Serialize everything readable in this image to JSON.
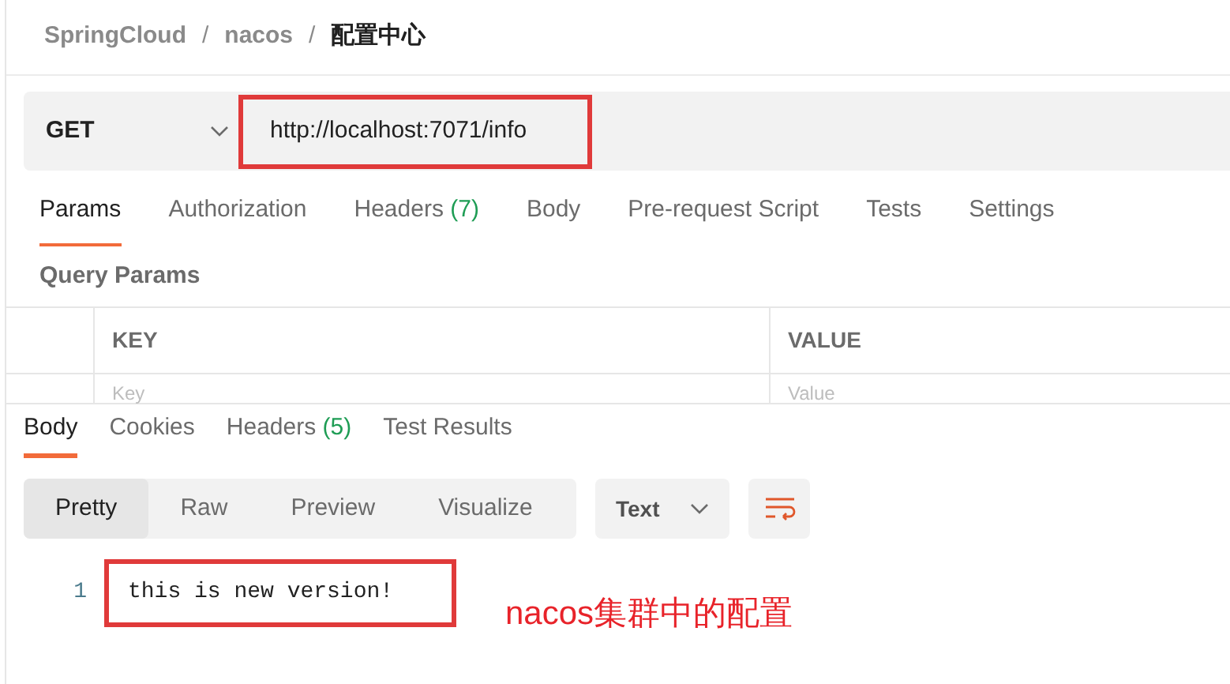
{
  "breadcrumb_separator": "/",
  "breadcrumb": [
    {
      "label": "SpringCloud",
      "current": false
    },
    {
      "label": "nacos",
      "current": false
    },
    {
      "label": "配置中心",
      "current": true
    }
  ],
  "request": {
    "method": "GET",
    "url": "http://localhost:7071/info"
  },
  "request_tabs": [
    {
      "label": "Params",
      "selected": true
    },
    {
      "label": "Authorization",
      "selected": false
    },
    {
      "label": "Headers",
      "count": "(7)",
      "selected": false
    },
    {
      "label": "Body",
      "selected": false
    },
    {
      "label": "Pre-request Script",
      "selected": false
    },
    {
      "label": "Tests",
      "selected": false
    },
    {
      "label": "Settings",
      "selected": false
    }
  ],
  "query_params": {
    "title": "Query Params",
    "columns": [
      "KEY",
      "VALUE"
    ],
    "placeholders": [
      "Key",
      "Value"
    ]
  },
  "response_tabs": [
    {
      "label": "Body",
      "selected": true
    },
    {
      "label": "Cookies",
      "selected": false
    },
    {
      "label": "Headers",
      "count": "(5)",
      "selected": false
    },
    {
      "label": "Test Results",
      "selected": false
    }
  ],
  "view_modes": [
    {
      "label": "Pretty",
      "selected": true
    },
    {
      "label": "Raw",
      "selected": false
    },
    {
      "label": "Preview",
      "selected": false
    },
    {
      "label": "Visualize",
      "selected": false
    }
  ],
  "format": "Text",
  "body_lines": [
    {
      "number": "1",
      "text": "this is new version!"
    }
  ],
  "annotation": "nacos集群中的配置"
}
